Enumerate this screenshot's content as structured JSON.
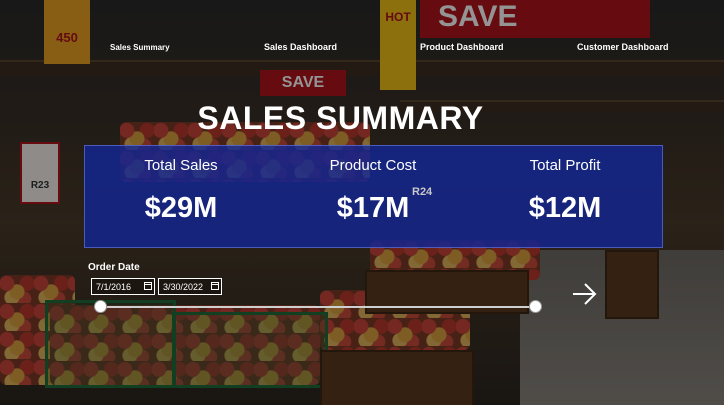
{
  "nav": {
    "items": [
      {
        "label": "Sales Summary"
      },
      {
        "label": "Sales Dashboard"
      },
      {
        "label": "Product Dashboard"
      },
      {
        "label": "Customer Dashboard"
      }
    ]
  },
  "page_title": "SALES SUMMARY",
  "kpis": [
    {
      "label": "Total Sales",
      "value": "$29M"
    },
    {
      "label": "Product Cost",
      "value": "$17M"
    },
    {
      "label": "Total Profit",
      "value": "$12M"
    }
  ],
  "slicer": {
    "title": "Order Date",
    "start": "7/1/2016",
    "end": "3/30/2022",
    "range_selected": [
      0,
      1
    ]
  },
  "background": {
    "banner_top": "SAVE",
    "banner_mid": "SAVE",
    "sign_left": "450",
    "price_a": "R23",
    "price_b": "R24",
    "sign_hot": "HOT"
  },
  "colors": {
    "panel": "#122696",
    "text": "#ffffff"
  },
  "icons": {
    "next_page": "arrow-right-icon",
    "calendar": "calendar-icon"
  }
}
